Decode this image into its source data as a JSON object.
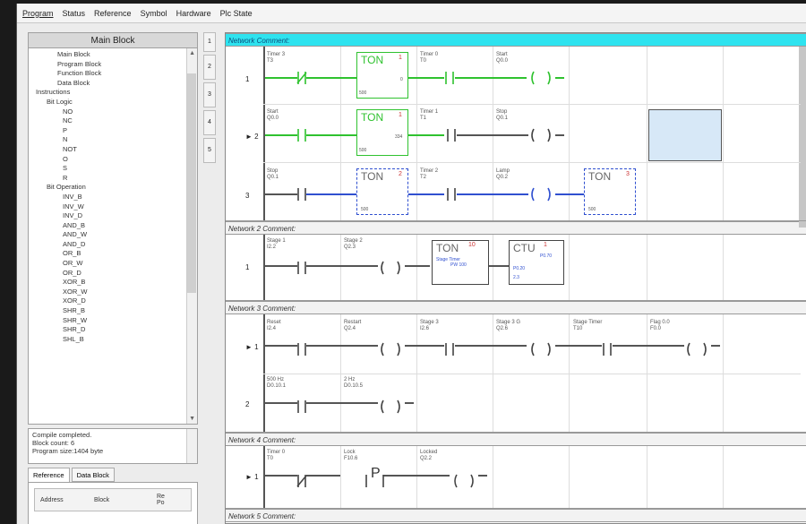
{
  "menubar": {
    "tabs": [
      "Program",
      "Status",
      "Reference",
      "Symbol",
      "Hardware",
      "Plc State"
    ]
  },
  "left": {
    "header": "Main Block",
    "tree": [
      "Main Block",
      "Program Block",
      "Function Block",
      "Data Block",
      "Instructions",
      "Bit Logic",
      "NO",
      "NC",
      "P",
      "N",
      "NOT",
      "O",
      "S",
      "R",
      "Bit Operation",
      "INV_B",
      "INV_W",
      "INV_D",
      "AND_B",
      "AND_W",
      "AND_D",
      "OR_B",
      "OR_W",
      "OR_D",
      "XOR_B",
      "XOR_W",
      "XOR_D",
      "SHR_B",
      "SHR_W",
      "SHR_D",
      "SHL_B"
    ],
    "status_lines": [
      "Compile completed.",
      "Block count: 6",
      "Program size:1404 byte"
    ],
    "tabs": [
      "Reference",
      "Data Block"
    ],
    "ref_cols": [
      "Address",
      "Block",
      "Re Po"
    ]
  },
  "row_numbers": [
    "1",
    "2",
    "3",
    "4",
    "5"
  ],
  "networks": [
    {
      "comment": "Network Comment:"
    },
    {
      "comment": "Network 2 Comment:"
    },
    {
      "comment": "Network 3 Comment:"
    },
    {
      "comment": "Network 4 Comment:"
    },
    {
      "comment": "Network 5 Comment:"
    }
  ],
  "rungs": {
    "n1r1": {
      "num": "1",
      "c1": "Timer 3",
      "c1a": "T3",
      "box": "TON",
      "boxn": "1",
      "pt": "500",
      "out": "0",
      "c2": "Timer 0",
      "c2a": "T0",
      "coil": "Start",
      "coila": "Q0.0"
    },
    "n1r2": {
      "num": "2",
      "c1": "Start",
      "c1a": "Q0.0",
      "box": "TON",
      "boxn": "1",
      "pt": "500",
      "out": "334",
      "c2": "Timer 1",
      "c2a": "T1",
      "coil": "Stop",
      "coila": "Q0.1"
    },
    "n1r3": {
      "num": "3",
      "c1": "Stop",
      "c1a": "Q0.1",
      "box": "TON",
      "boxn": "2",
      "pt": "500",
      "c2": "Timer 2",
      "c2a": "T2",
      "coil": "Lamp",
      "coila": "Q0.2",
      "box2": "TON",
      "box2n": "3",
      "pt2": "500"
    },
    "n2r1": {
      "num": "1",
      "c1": "Stage 1",
      "c1a": "I2.2",
      "coil": "Stage 2",
      "coila": "Q2.3",
      "box": "TON",
      "boxn": "10",
      "bsub": "Stage Timer",
      "bsub2": "PW 100",
      "box2": "CTU",
      "box2n": "1",
      "b2sub": "P0.70",
      "b2a": "P0.20",
      "b2b": "2.3"
    },
    "n3r1": {
      "num": "1",
      "c1": "Reset",
      "c1a": "I2.4",
      "coil": "Restart",
      "coila": "Q2.4",
      "c2": "Stage 3",
      "c2a": "I2.6",
      "coil2": "Stage 3 G",
      "coil2a": "Q2.6",
      "c3": "Stage Timer",
      "c3a": "T10",
      "coil3": "Flag 0.0",
      "coil3a": "F0.0"
    },
    "n3r2": {
      "num": "2",
      "c1": "500 Hz",
      "c1a": "D0.10.1",
      "coil": "2 Hz",
      "coila": "D0.10.5"
    },
    "n4r1": {
      "num": "1",
      "c1": "Timer 0",
      "c1a": "T0",
      "c2": "Lock",
      "c2a": "F10.6",
      "p": "P",
      "coil": "Locked",
      "coila": "Q2.2"
    }
  }
}
